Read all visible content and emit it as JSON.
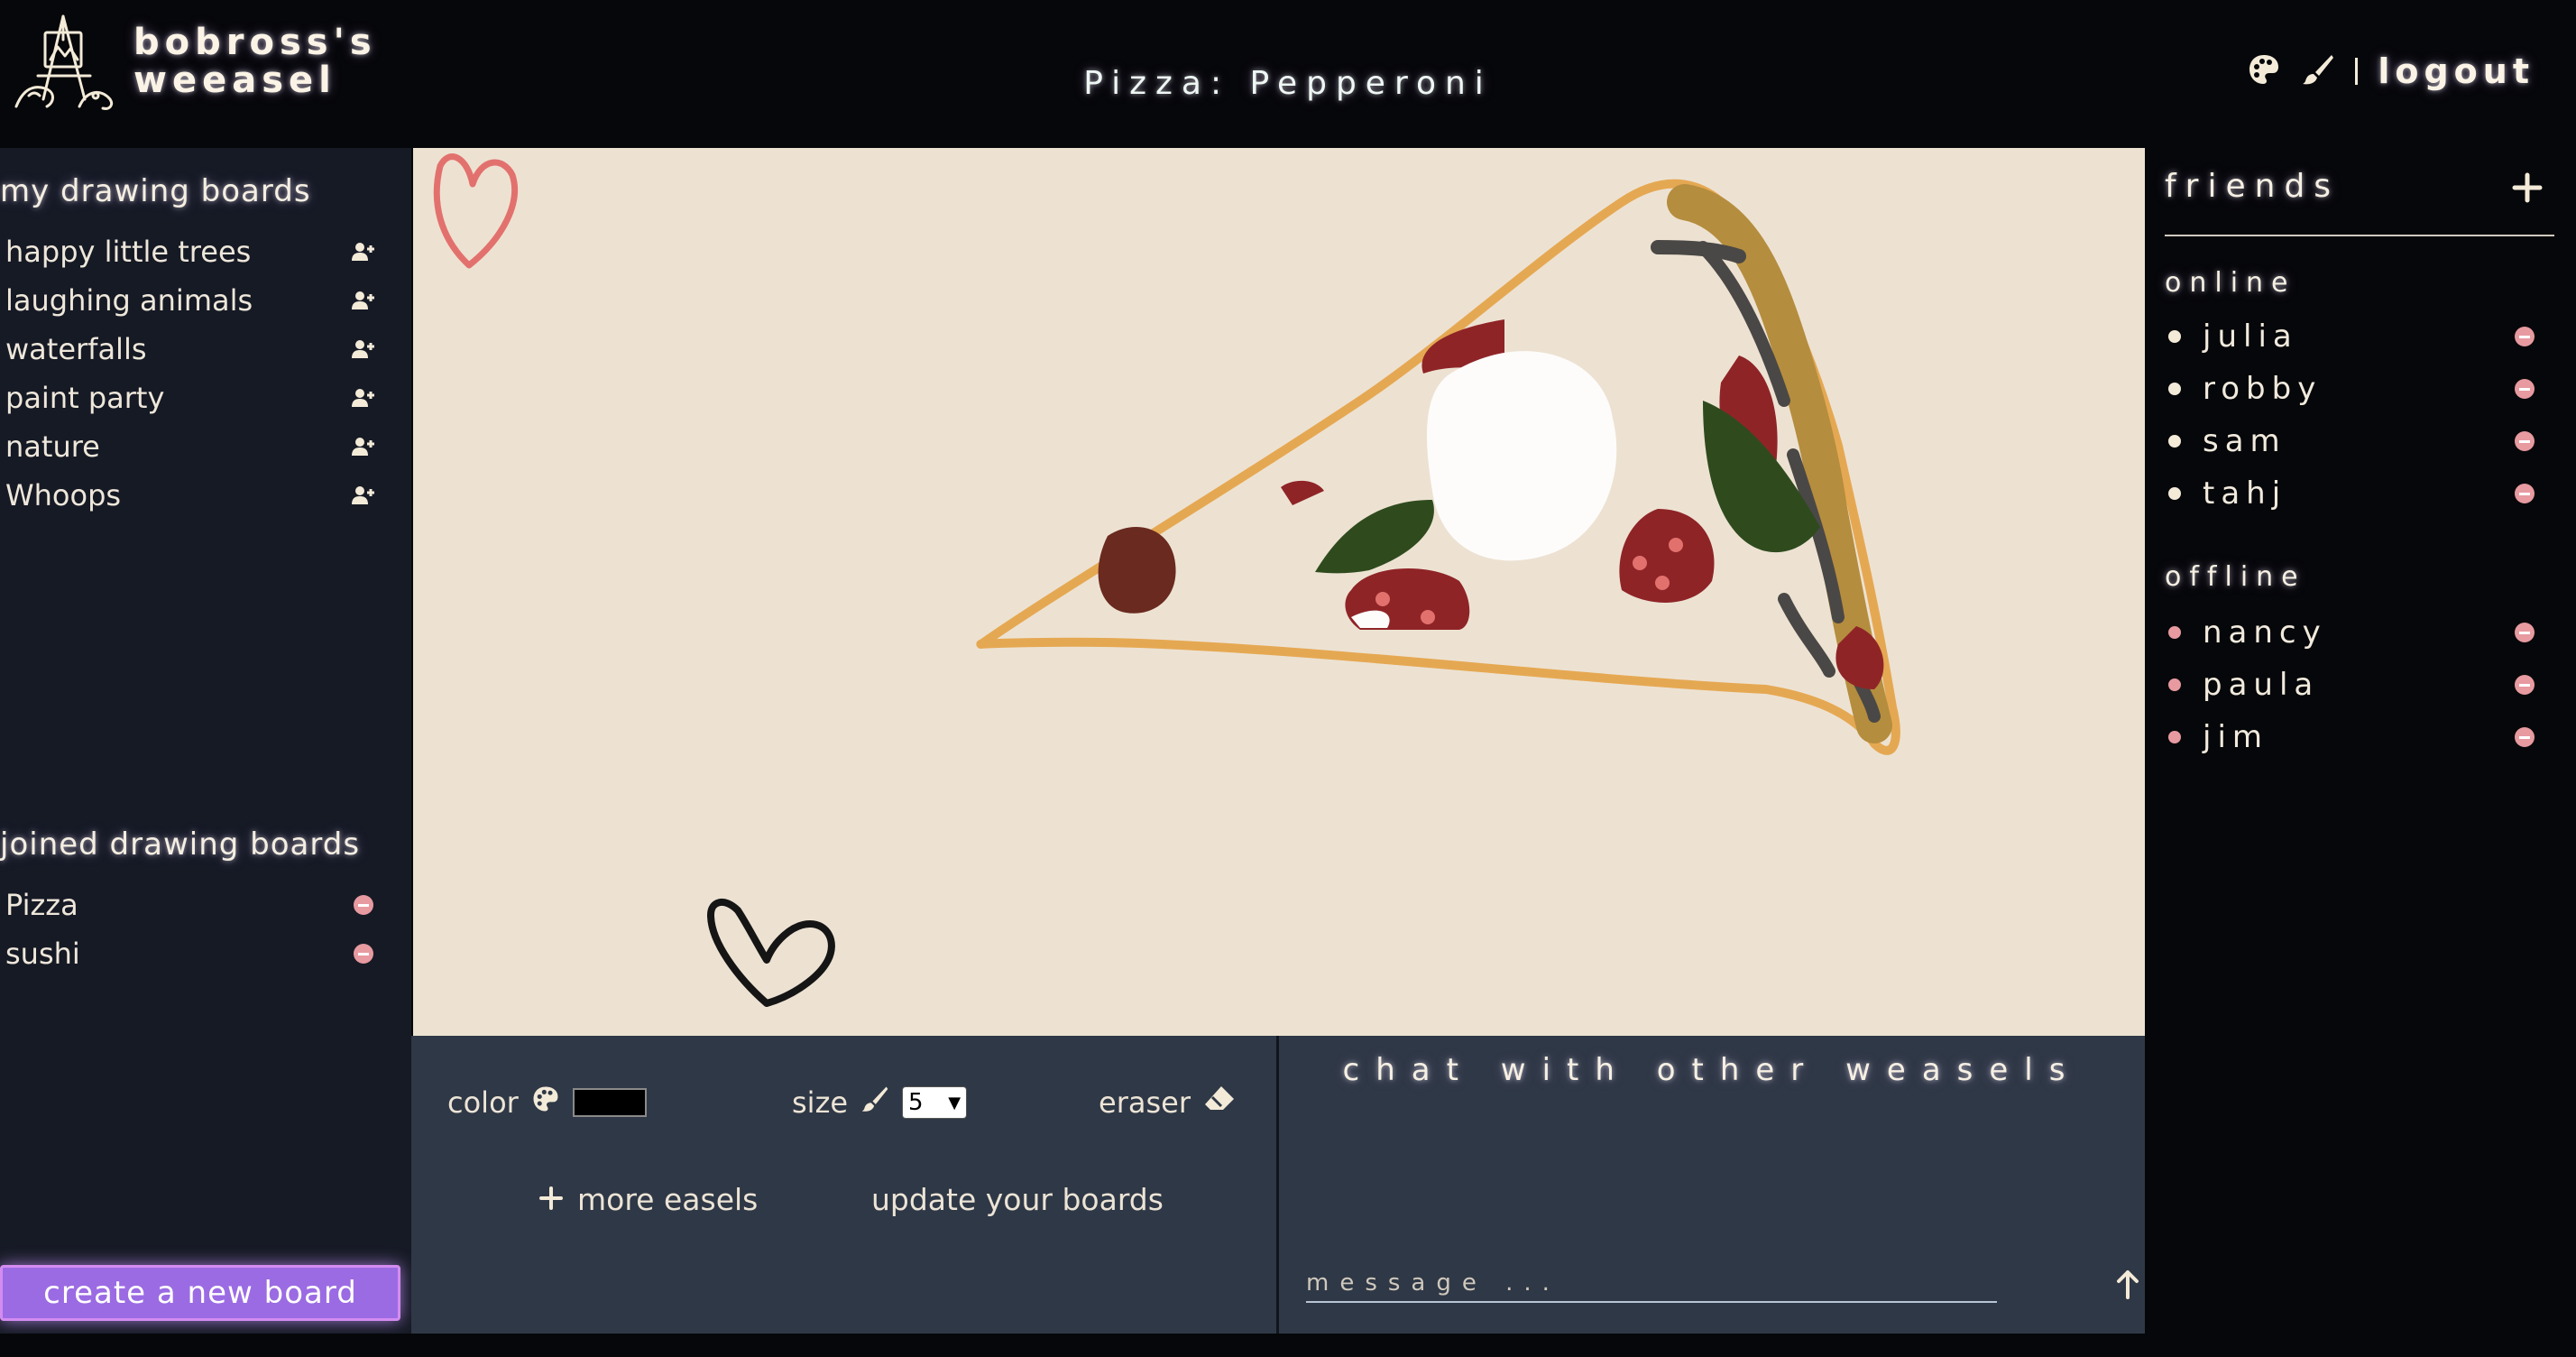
{
  "header": {
    "app_name_line1": "bobross's",
    "app_name_line2": "weeasel",
    "board_title": "Pizza: Pepperoni",
    "logout_label": "logout"
  },
  "sidebar": {
    "my_boards_heading": "my drawing boards",
    "my_boards": [
      {
        "label": "happy little trees"
      },
      {
        "label": "laughing animals"
      },
      {
        "label": "waterfalls"
      },
      {
        "label": "paint party"
      },
      {
        "label": "nature"
      },
      {
        "label": "Whoops"
      }
    ],
    "joined_heading": "joined drawing boards",
    "joined_boards": [
      {
        "label": "Pizza"
      },
      {
        "label": "sushi"
      }
    ],
    "create_button": "create a new board"
  },
  "tools": {
    "color_label": "color",
    "color_value": "#000000",
    "size_label": "size",
    "size_value": "5",
    "eraser_label": "eraser",
    "more_easels_label": "more easels",
    "update_boards_label": "update your boards"
  },
  "chat": {
    "title": "chat with other weasels",
    "placeholder": "message ..."
  },
  "friends": {
    "title": "friends",
    "online_heading": "online",
    "online": [
      {
        "name": "julia"
      },
      {
        "name": "robby"
      },
      {
        "name": "sam"
      },
      {
        "name": "tahj"
      }
    ],
    "offline_heading": "offline",
    "offline": [
      {
        "name": "nancy"
      },
      {
        "name": "paula"
      },
      {
        "name": "jim"
      }
    ]
  },
  "colors": {
    "canvas_bg": "#ede2d2",
    "panel_bg": "#2f3846",
    "sidebar_bg": "#161a25",
    "accent_purple": "#9b6be3",
    "online_dot": "#f3ead8",
    "offline_dot": "#e79aa0"
  },
  "icons": {
    "logo": "easel-logo-icon",
    "palette": "palette-icon",
    "brush": "brush-icon",
    "eraser": "eraser-icon",
    "add_user": "add-user-icon",
    "remove": "remove-icon",
    "send": "send-arrow-icon",
    "plus": "plus-icon"
  }
}
